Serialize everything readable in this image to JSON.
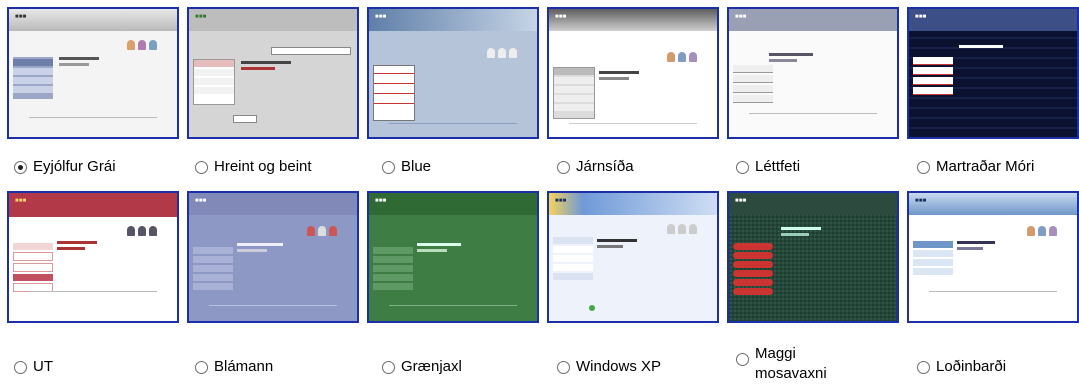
{
  "themes": [
    {
      "label": "Eyjólfur Grái",
      "selected": true
    },
    {
      "label": "Hreint og beint",
      "selected": false
    },
    {
      "label": "Blue",
      "selected": false
    },
    {
      "label": "Járnsíða",
      "selected": false
    },
    {
      "label": "Léttfeti",
      "selected": false
    },
    {
      "label": "Martraðar Móri",
      "selected": false
    },
    {
      "label": "UT",
      "selected": false
    },
    {
      "label": "Blámann",
      "selected": false
    },
    {
      "label": "Grænjaxl",
      "selected": false
    },
    {
      "label": "Windows XP",
      "selected": false
    },
    {
      "label": "Maggi mosavaxni",
      "selected": false
    },
    {
      "label": "Loðinbarði",
      "selected": false
    }
  ],
  "colors": {
    "thumbnail_border": "#1b2fa8",
    "eyjolfur_header": "#c9c9c9",
    "hreint_header": "#b7b7b7",
    "blue_header": "#7e98b8",
    "jarn_header": "#8a8a8a",
    "lett_header": "#8e93a8",
    "martr_bg": "#0b1430",
    "ut_header": "#b23a48",
    "blamann_bg": "#7e8ab8",
    "graenjaxl_bg": "#3e7e45",
    "xp_header": "#6f9ad8",
    "maggi_bg": "#27483a",
    "lodin_header": "#6f96c8"
  }
}
